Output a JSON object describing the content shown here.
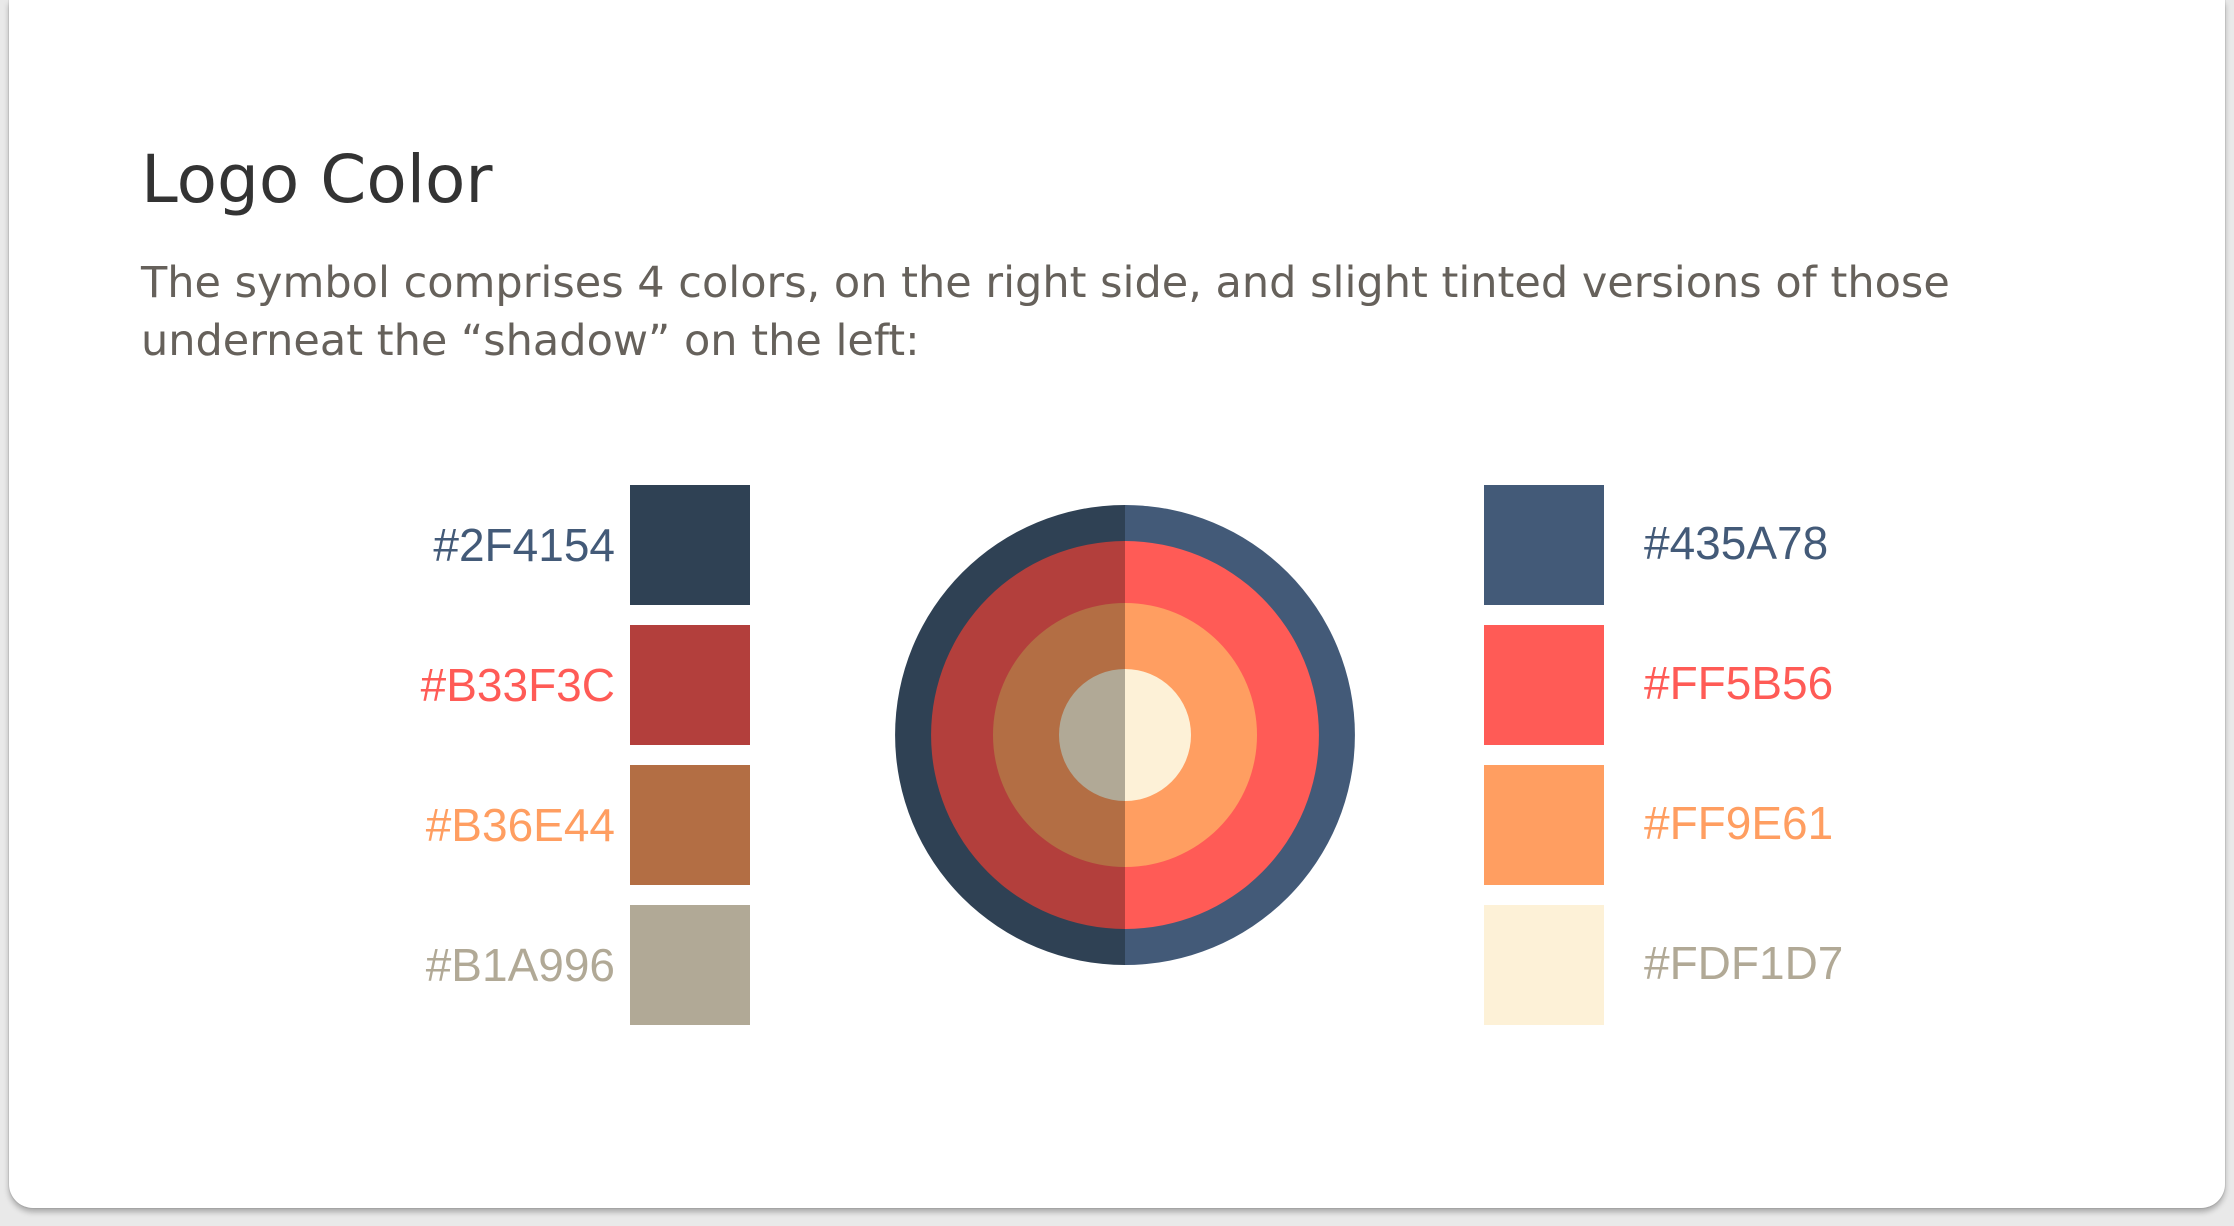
{
  "title": "Logo Color",
  "description": {
    "line1": "The symbol comprises 4 colors, on the right side, and slight tinted versions of those",
    "line2": "underneat the “shadow” on the left:"
  },
  "left_colors": [
    {
      "hex": "#2F4154",
      "label_color": "#435a78"
    },
    {
      "hex": "#B33F3C",
      "label_color": "#ff5b56"
    },
    {
      "hex": "#B36E44",
      "label_color": "#ff9e61"
    },
    {
      "hex": "#B1A996",
      "label_color": "#b1a996"
    }
  ],
  "right_colors": [
    {
      "hex": "#435A78",
      "label_color": "#435a78"
    },
    {
      "hex": "#FF5B56",
      "label_color": "#ff5b56"
    },
    {
      "hex": "#FF9E61",
      "label_color": "#ff9e61"
    },
    {
      "hex": "#FDF1D7",
      "label_color": "#b1a996"
    }
  ]
}
